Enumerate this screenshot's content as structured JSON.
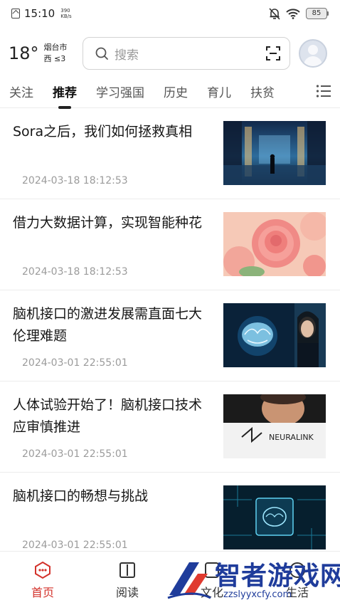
{
  "status_bar": {
    "time": "15:10",
    "net_speed_value": "390",
    "net_speed_unit": "KB/s",
    "battery": "85"
  },
  "header": {
    "temperature": "18°",
    "city": "烟台市",
    "wind": "西  ≤3",
    "search_placeholder": "搜索"
  },
  "tabs": [
    "关注",
    "推荐",
    "学习强国",
    "历史",
    "育儿",
    "扶贫"
  ],
  "active_tab": "推荐",
  "news": [
    {
      "title": "Sora之后，我们如何拯救真相",
      "time": "2024-03-18 18:12:53",
      "image": "futuristic-corridor-figure"
    },
    {
      "title": "借力大数据计算，实现智能种花",
      "time": "2024-03-18 18:12:53",
      "image": "pink-roses"
    },
    {
      "title": "脑机接口的激进发展需直面七大伦理难题",
      "time": "2024-03-01 22:55:01",
      "image": "glowing-brain-woman"
    },
    {
      "title": "人体试验开始了！脑机接口技术应审慎推进",
      "time": "2024-03-01 22:55:01",
      "image": "neuralink-logo-portrait"
    },
    {
      "title": "脑机接口的畅想与挑战",
      "time": "2024-03-01 22:55:01",
      "image": "circuit-brain-chip"
    }
  ],
  "thumb_logo_text": "NEURALINK",
  "bottom_nav": [
    {
      "label": "首页",
      "icon": "home-chat-icon",
      "active": true
    },
    {
      "label": "阅读",
      "icon": "book-icon",
      "active": false
    },
    {
      "label": "文化",
      "icon": "culture-icon",
      "active": false
    },
    {
      "label": "生活",
      "icon": "life-icon",
      "active": false
    }
  ],
  "watermark": {
    "text": "智者游戏网",
    "url": "zzslyyxcfy.com"
  },
  "colors": {
    "accent": "#d3322b",
    "watermark": "#1f3c9b"
  }
}
